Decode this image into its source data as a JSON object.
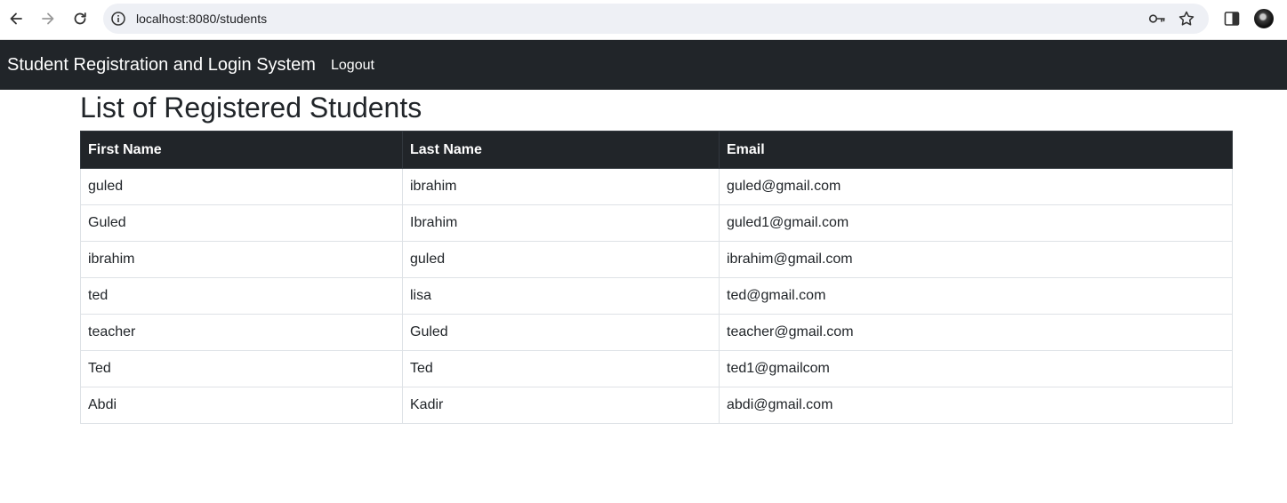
{
  "browser": {
    "url": "localhost:8080/students",
    "icons": [
      "back-arrow-icon",
      "forward-arrow-icon",
      "reload-icon",
      "site-info-icon",
      "password-key-icon",
      "bookmark-star-icon",
      "side-panel-icon"
    ]
  },
  "navbar": {
    "brand": "Student Registration and Login System",
    "logout_label": "Logout",
    "background": "#212529"
  },
  "page": {
    "title": "List of Registered Students"
  },
  "table": {
    "columns": [
      "First Name",
      "Last Name",
      "Email"
    ],
    "rows": [
      [
        "guled",
        "ibrahim",
        "guled@gmail.com"
      ],
      [
        "Guled",
        "Ibrahim",
        "guled1@gmail.com"
      ],
      [
        "ibrahim",
        "guled",
        "ibrahim@gmail.com"
      ],
      [
        "ted",
        "lisa",
        "ted@gmail.com"
      ],
      [
        "teacher",
        "Guled",
        "teacher@gmail.com"
      ],
      [
        "Ted",
        "Ted",
        "ted1@gmailcom"
      ],
      [
        "Abdi",
        "Kadir",
        "abdi@gmail.com"
      ]
    ]
  }
}
